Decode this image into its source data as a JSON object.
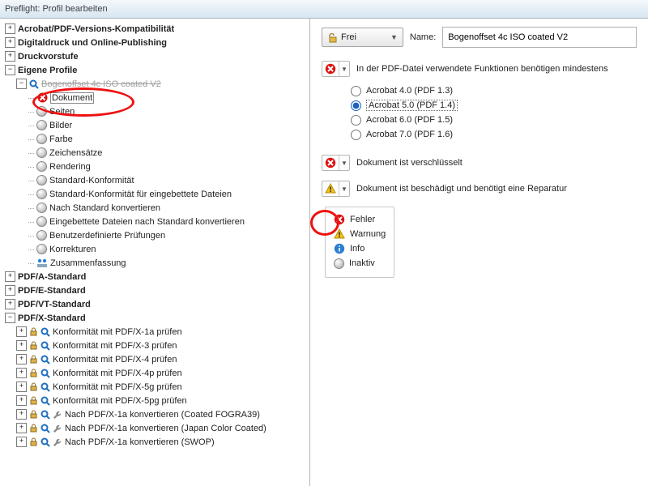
{
  "window": {
    "title": "Preflight: Profil bearbeiten"
  },
  "tree": {
    "acrobat_compat": "Acrobat/PDF-Versions-Kompatibilität",
    "digitaldruck": "Digitaldruck und Online-Publishing",
    "druckvorstufe": "Druckvorstufe",
    "eigene": "Eigene Profile",
    "profile1": "Bogenoffset 4c ISO coated V2",
    "dokument": "Dokument",
    "seiten": "Seiten",
    "bilder": "Bilder",
    "farbe": "Farbe",
    "zeichen": "Zeichensätze",
    "rendering": "Rendering",
    "konf": "Standard-Konformität",
    "konf_emb": "Standard-Konformität für eingebettete Dateien",
    "konvert": "Nach Standard konvertieren",
    "emb_konvert": "Eingebettete Dateien nach Standard konvertieren",
    "benutzer": "Benutzerdefinierte Prüfungen",
    "korrekturen": "Korrekturen",
    "zusammen": "Zusammenfassung",
    "pdfa": "PDF/A-Standard",
    "pdfe": "PDF/E-Standard",
    "pdfvt": "PDF/VT-Standard",
    "pdfx": "PDF/X-Standard",
    "x1a": "Konformität mit PDF/X-1a prüfen",
    "x3": "Konformität mit PDF/X-3 prüfen",
    "x4": "Konformität mit PDF/X-4 prüfen",
    "x4p": "Konformität mit PDF/X-4p prüfen",
    "x5g": "Konformität mit PDF/X-5g prüfen",
    "x5pg": "Konformität mit PDF/X-5pg prüfen",
    "nx1a_fogra": "Nach PDF/X-1a konvertieren (Coated FOGRA39)",
    "nx1a_japan": "Nach PDF/X-1a konvertieren (Japan Color Coated)",
    "nx1a_swop": "Nach PDF/X-1a konvertieren (SWOP)"
  },
  "right": {
    "lock_label": "Frei",
    "name_label": "Name:",
    "name_value": "Bogenoffset 4c ISO coated V2",
    "sec1": "In der PDF-Datei verwendete Funktionen benötigen mindestens",
    "r1": "Acrobat 4.0 (PDF 1.3)",
    "r2": "Acrobat 5.0 (PDF 1.4)",
    "r3": "Acrobat 6.0 (PDF 1.5)",
    "r4": "Acrobat 7.0 (PDF 1.6)",
    "sec2": "Dokument ist verschlüsselt",
    "sec3": "Dokument ist beschädigt und benötigt eine Reparatur",
    "lg_err": "Fehler",
    "lg_warn": "Warnung",
    "lg_info": "Info",
    "lg_inakt": "Inaktiv"
  }
}
